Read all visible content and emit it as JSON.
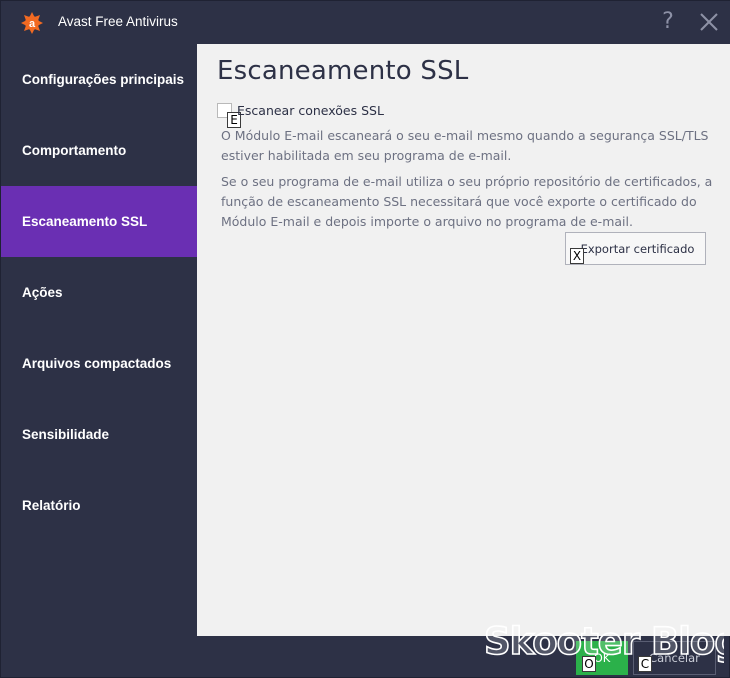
{
  "window": {
    "title": "Avast Free Antivirus",
    "help_label": "?"
  },
  "sidebar": {
    "items": [
      {
        "label": "Configurações principais",
        "active": false
      },
      {
        "label": "Comportamento",
        "active": false
      },
      {
        "label": "Escaneamento SSL",
        "active": true
      },
      {
        "label": "Ações",
        "active": false
      },
      {
        "label": "Arquivos compactados",
        "active": false
      },
      {
        "label": "Sensibilidade",
        "active": false
      },
      {
        "label": "Relatório",
        "active": false
      }
    ]
  },
  "content": {
    "title": "Escaneamento SSL",
    "checkbox": {
      "label": "Escanear conexões SSL",
      "checked": false,
      "hotkey": "E"
    },
    "paragraph1": "O Módulo E-mail escaneará o seu e-mail mesmo quando a segurança SSL/TLS estiver habilitada em seu programa de e-mail.",
    "paragraph2": "Se o seu programa de e-mail utiliza o seu próprio repositório de certificados, a função de escaneamento SSL necessitará que você exporte o certificado do Módulo E-mail e depois importe o arquivo no programa de e-mail.",
    "export_button": {
      "label": "Exportar certificado",
      "hotkey": "X"
    }
  },
  "footer": {
    "ok_label": "OK",
    "ok_hotkey": "O",
    "cancel_label": "Cancelar",
    "cancel_hotkey": "C"
  },
  "watermark": {
    "text": "Skooter Blog"
  },
  "icons": {
    "logo": "avast-logo-icon",
    "close": "close-icon"
  },
  "colors": {
    "accent": "#6a2fb3",
    "sidebar_bg": "#2d3146",
    "content_bg": "#f1f1f1",
    "ok_green": "#2bb14a",
    "logo_orange": "#f26a22"
  }
}
